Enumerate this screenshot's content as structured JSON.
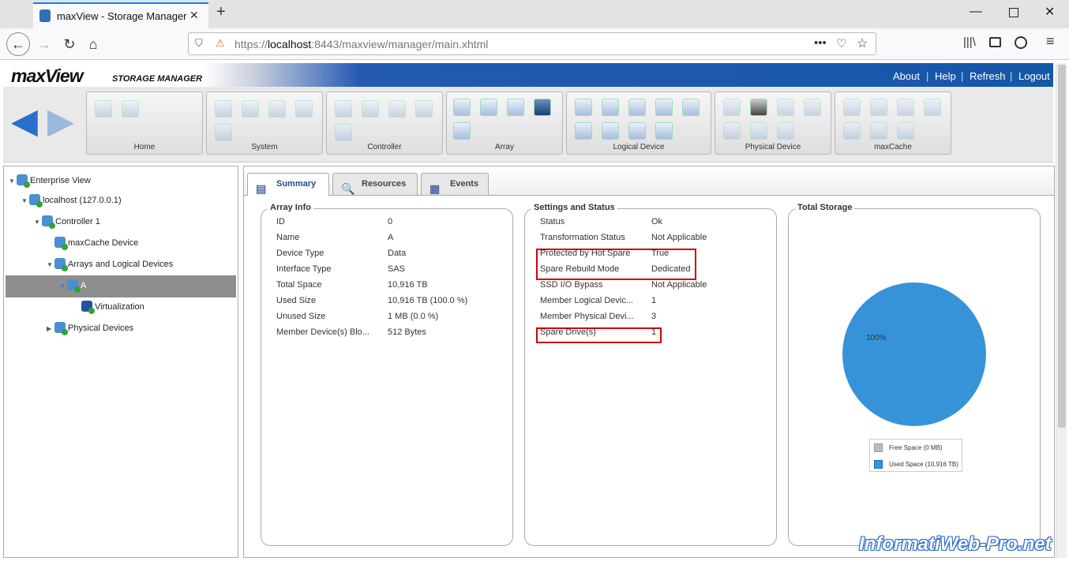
{
  "browser": {
    "tab_title": "maxView - Storage Manager",
    "url_scheme": "https://",
    "url_host": "localhost",
    "url_rest": ":8443/maxview/manager/main.xhtml",
    "window_controls": [
      "minimize-icon",
      "maximize-icon",
      "close-icon"
    ]
  },
  "app": {
    "logo_main": "maxView",
    "logo_sub": "STORAGE MANAGER",
    "links": {
      "about": "About",
      "help": "Help",
      "refresh": "Refresh",
      "logout": "Logout"
    },
    "brand_color": "#1557a8"
  },
  "toolbar": {
    "groups": [
      {
        "label": "Home"
      },
      {
        "label": "System"
      },
      {
        "label": "Controller"
      },
      {
        "label": "Array"
      },
      {
        "label": "Logical Device"
      },
      {
        "label": "Physical Device"
      },
      {
        "label": "maxCache"
      }
    ]
  },
  "tree": {
    "enterprise": "Enterprise View",
    "host": "localhost (127.0.0.1)",
    "controller": "Controller 1",
    "maxcache": "maxCache Device",
    "arrays": "Arrays and Logical Devices",
    "array_a": "A",
    "virtualization": "Virtualization",
    "physical": "Physical Devices"
  },
  "tabs": {
    "summary": "Summary",
    "resources": "Resources",
    "events": "Events"
  },
  "array_info": {
    "title": "Array Info",
    "rows": [
      {
        "k": "ID",
        "v": "0"
      },
      {
        "k": "Name",
        "v": "A"
      },
      {
        "k": "Device Type",
        "v": "Data"
      },
      {
        "k": "Interface Type",
        "v": "SAS"
      },
      {
        "k": "Total Space",
        "v": "10,916 TB"
      },
      {
        "k": "Used Size",
        "v": "10,916 TB (100.0 %)"
      },
      {
        "k": "Unused Size",
        "v": "1 MB (0.0 %)"
      },
      {
        "k": "Member Device(s) Blo...",
        "v": "512 Bytes"
      }
    ]
  },
  "settings": {
    "title": "Settings and Status",
    "rows": [
      {
        "k": "Status",
        "v": "Ok"
      },
      {
        "k": "Transformation Status",
        "v": "Not Applicable"
      },
      {
        "k": "Protected by Hot Spare",
        "v": "True"
      },
      {
        "k": "Spare Rebuild Mode",
        "v": "Dedicated"
      },
      {
        "k": "SSD I/O Bypass",
        "v": "Not Applicable"
      },
      {
        "k": "Member Logical Devic...",
        "v": "1"
      },
      {
        "k": "Member Physical Devi...",
        "v": "3"
      },
      {
        "k": "Spare Drive(s)",
        "v": "1"
      }
    ]
  },
  "storage": {
    "title": "Total Storage",
    "pie_label": "100%",
    "used_fraction": 1.0,
    "legend": [
      {
        "label": "Free Space (0 MB)",
        "color": "#bdbdbd"
      },
      {
        "label": "Used Space (10,916 TB)",
        "color": "#3793d8"
      }
    ]
  },
  "watermark": "InformatiWeb-Pro.net"
}
